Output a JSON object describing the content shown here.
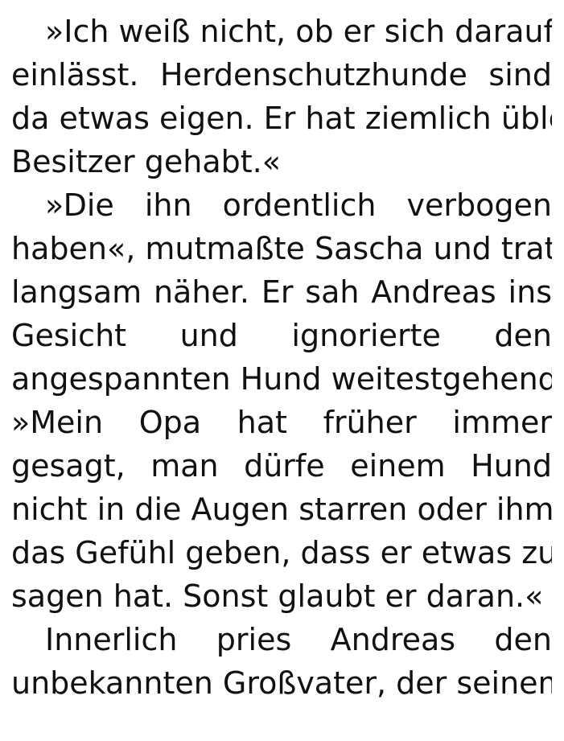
{
  "paragraphs": [
    {
      "lines": [
        "»Ich weiß nicht, ob er sich darauf",
        "einlässt. Herdenschutzhunde sind",
        "da etwas eigen. Er hat ziemlich üble",
        "Besitzer gehabt.«"
      ]
    },
    {
      "lines": [
        "»Die ihn ordentlich verbogen",
        "haben«, mutmaßte Sascha und trat",
        "langsam näher. Er sah Andreas ins",
        "Gesicht und ignorierte den",
        "angespannten Hund weitestgehend.",
        "»Mein Opa hat früher immer",
        "gesagt, man dürfe einem Hund",
        "nicht in die Augen starren oder ihm",
        "das Gefühl geben, dass er etwas zu",
        "sagen hat. Sonst glaubt er daran.«"
      ]
    },
    {
      "lines": [
        "Innerlich pries Andreas den",
        "unbekannten Großvater, der seinem"
      ]
    }
  ]
}
